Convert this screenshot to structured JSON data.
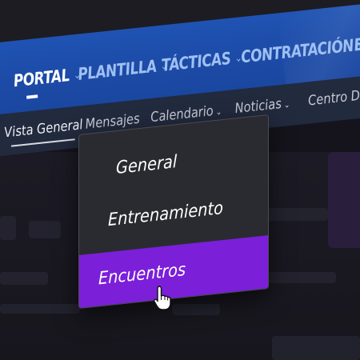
{
  "main_nav": {
    "items": [
      {
        "label": "PORTAL",
        "active": true
      },
      {
        "label": "PLANTILLA",
        "active": false
      },
      {
        "label": "TÁCTICAS",
        "active": false
      },
      {
        "label": "CONTRATACIÓN",
        "active": false
      },
      {
        "label": "E",
        "active": false
      }
    ],
    "chevron": "⌄"
  },
  "sub_nav": {
    "items": [
      {
        "label": "Vista General",
        "active": true
      },
      {
        "label": "Mensajes",
        "active": false
      },
      {
        "label": "Calendario",
        "active": false
      },
      {
        "label": "Noticias",
        "active": false
      },
      {
        "label": "Centro De",
        "active": false
      }
    ],
    "chevron": "⌄"
  },
  "dropdown": {
    "items": [
      {
        "label": "General",
        "selected": false
      },
      {
        "label": "Entrenamiento",
        "selected": false
      },
      {
        "label": "Encuentros",
        "selected": true
      }
    ]
  },
  "colors": {
    "nav_blue": "#1f53b3",
    "sub_nav": "#222a3e",
    "dropdown_bg": "#2a2b30",
    "selected_purple": "#7b1fd9"
  }
}
